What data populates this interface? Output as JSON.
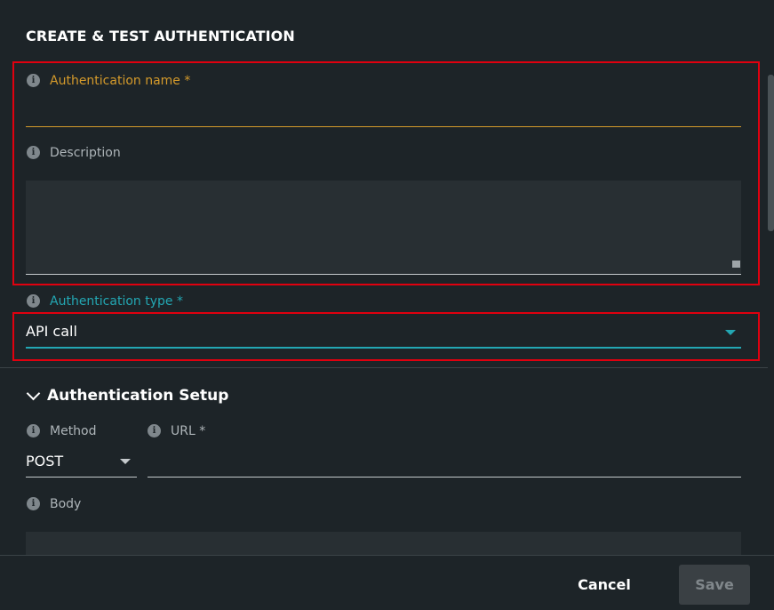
{
  "dialog": {
    "title": "CREATE & TEST AUTHENTICATION"
  },
  "fields": {
    "auth_name": {
      "label": "Authentication name *",
      "value": "",
      "placeholder": ""
    },
    "description": {
      "label": "Description",
      "value": "",
      "placeholder": ""
    },
    "auth_type": {
      "label": "Authentication type *",
      "value": "API call"
    }
  },
  "setup": {
    "title": "Authentication Setup",
    "method": {
      "label": "Method",
      "value": "POST"
    },
    "url": {
      "label": "URL *",
      "value": "",
      "placeholder": ""
    },
    "body": {
      "label": "Body"
    }
  },
  "footer": {
    "cancel_label": "Cancel",
    "save_label": "Save"
  },
  "icons": {
    "info": "info-icon",
    "dropdown": "caret-down-icon",
    "section_toggle": "chevron-down-icon"
  },
  "colors": {
    "background": "#1d2428",
    "field_background": "#282f33",
    "focus_accent": "#d49a2b",
    "teal_accent": "#23a7b3",
    "highlight_border": "#e0000f",
    "save_disabled": "#3a4044"
  }
}
